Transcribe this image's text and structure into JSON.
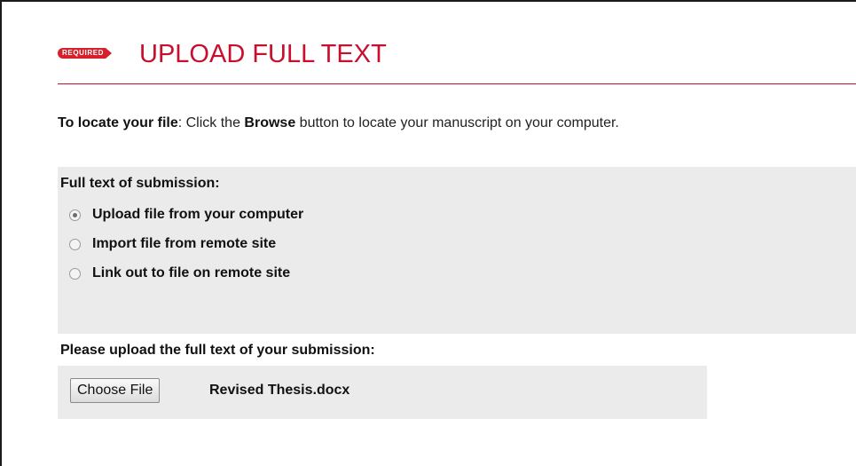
{
  "header": {
    "badge_label": "REQUIRED",
    "title": "UPLOAD FULL TEXT"
  },
  "instructions": {
    "lead_bold": "To locate your file",
    "text_1": ": Click the ",
    "browse_bold": "Browse",
    "text_2": " button to locate your manuscript on your computer."
  },
  "full_text": {
    "label": "Full text of submission:",
    "options": [
      {
        "label": "Upload file from your computer",
        "checked": true
      },
      {
        "label": "Import file from remote site",
        "checked": false
      },
      {
        "label": "Link out to file on remote site",
        "checked": false
      }
    ]
  },
  "upload": {
    "label": "Please upload the full text of your submission:",
    "button_label": "Choose File",
    "file_name": "Revised Thesis.docx"
  },
  "colors": {
    "accent": "#c8102e",
    "badge": "#d6202b",
    "panel_bg": "#ebebeb"
  }
}
